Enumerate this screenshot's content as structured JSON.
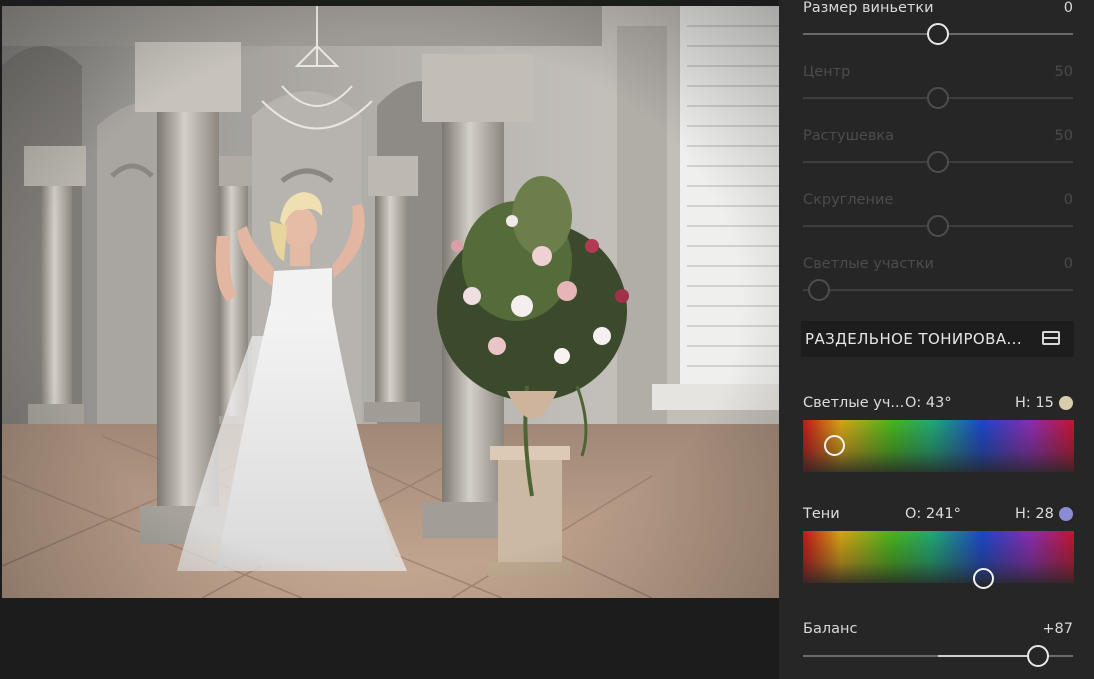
{
  "vignette": {
    "size_label": "Размер виньетки",
    "size_value": "0",
    "size_pos": 0.5,
    "center_label": "Центр",
    "center_value": "50",
    "center_pos": 0.5,
    "feather_label": "Растушевка",
    "feather_value": "50",
    "feather_pos": 0.5,
    "roundness_label": "Скругление",
    "roundness_value": "0",
    "roundness_pos": 0.5,
    "highlights_label": "Светлые участки",
    "highlights_value": "0",
    "highlights_pos": 0.06
  },
  "split_toning": {
    "header": "РАЗДЕЛЬНОЕ ТОНИРОВА...",
    "highlights": {
      "label": "Светлые уч...",
      "hue_text": "О: 43°",
      "sat_text": "Н: 15",
      "swatch_color": "#d8ccac",
      "hue": 43,
      "saturation": 15
    },
    "shadows": {
      "label": "Тени",
      "hue_text": "О: 241°",
      "sat_text": "Н: 28",
      "swatch_color": "#8c8cd6",
      "hue": 241,
      "saturation": 28
    },
    "balance_label": "Баланс",
    "balance_value": "+87",
    "balance_pos": 0.87
  },
  "colors": {
    "panel_bg": "#262626",
    "active_text": "#d8d8d8",
    "disabled_text": "#4c4c4c"
  }
}
